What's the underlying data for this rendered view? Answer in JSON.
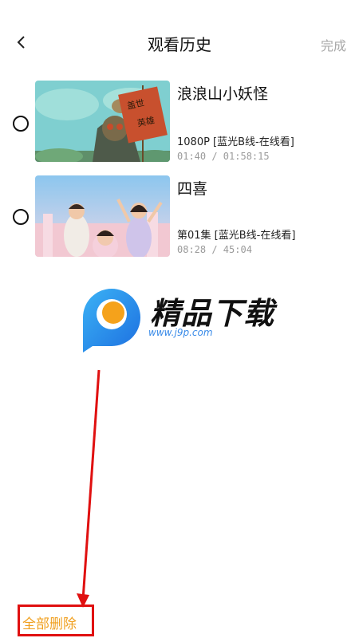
{
  "header": {
    "back_icon": "chevron-left-icon",
    "title": "观看历史",
    "done_label": "完成",
    "done_color": "#a8a8a8"
  },
  "history": [
    {
      "title": "浪浪山小妖怪",
      "quality": "1080P [蓝光B线-在线看]",
      "progress": "01:40 / 01:58:15",
      "poster_sign": "盖世英雄"
    },
    {
      "title": "四喜",
      "quality": "第01集 [蓝光B线-在线看]",
      "progress": "08:28 / 45:04"
    }
  ],
  "watermark": {
    "name": "精品下载",
    "url": "www.j9p.com"
  },
  "footer": {
    "delete_all_label": "全部删除",
    "accent": "#f0a020",
    "highlight": "#e01010"
  }
}
